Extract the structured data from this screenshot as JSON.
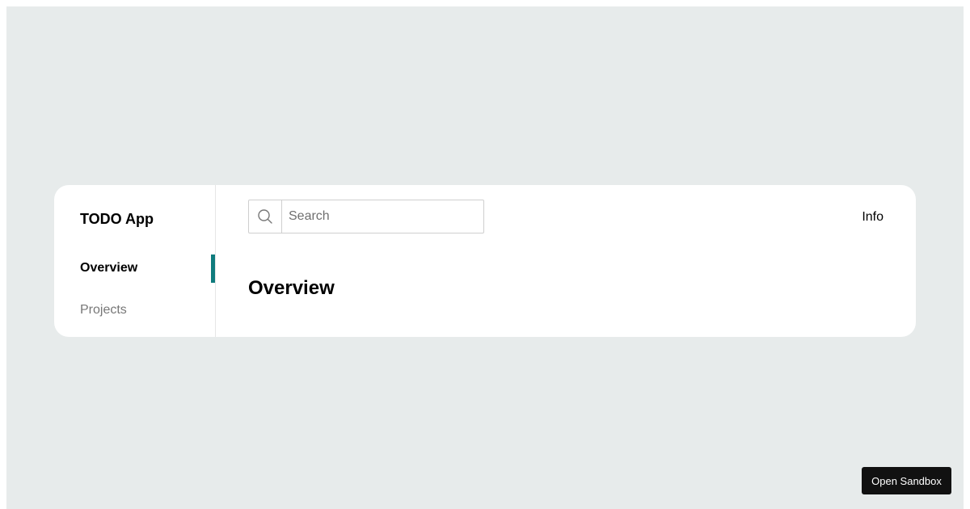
{
  "app": {
    "title": "TODO App"
  },
  "sidebar": {
    "items": [
      {
        "label": "Overview",
        "active": true
      },
      {
        "label": "Projects",
        "active": false
      }
    ]
  },
  "header": {
    "search": {
      "placeholder": "Search",
      "value": "",
      "icon": "search-icon"
    },
    "info_label": "Info"
  },
  "main": {
    "heading": "Overview"
  },
  "sandbox_button": {
    "label": "Open Sandbox"
  },
  "colors": {
    "page_background": "#e7ebeb",
    "card_background": "#ffffff",
    "accent": "#0f7b7d",
    "sandbox_button_background": "#111111"
  }
}
